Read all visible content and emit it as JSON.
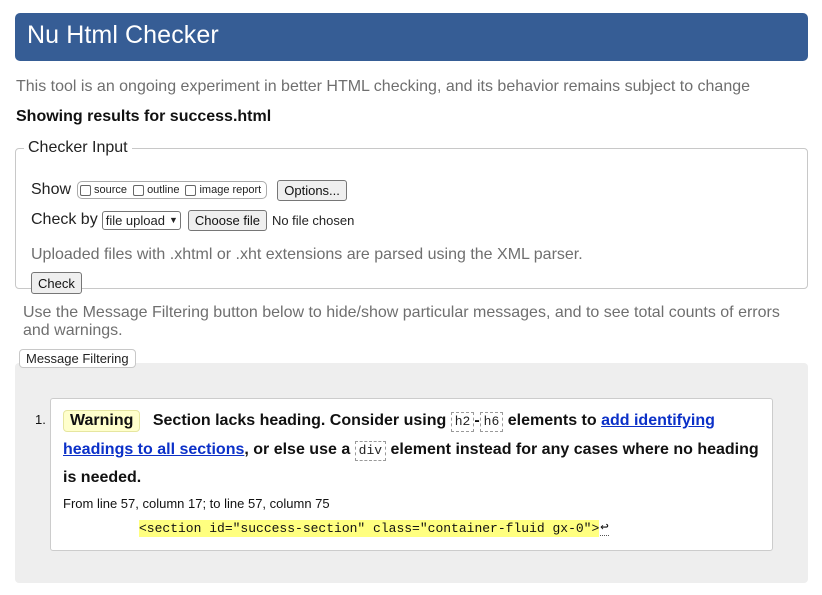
{
  "header": {
    "title": "Nu Html Checker"
  },
  "intro_text": "This tool is an ongoing experiment in better HTML checking, and its behavior remains subject to change",
  "results_for": "Showing results for success.html",
  "checker_input": {
    "legend": "Checker Input",
    "show_label": "Show",
    "checkboxes": [
      {
        "label": "source",
        "checked": false
      },
      {
        "label": "outline",
        "checked": false
      },
      {
        "label": "image report",
        "checked": false
      }
    ],
    "options_button": "Options...",
    "check_by_label": "Check by",
    "check_by_value": "file upload",
    "choose_file_button": "Choose file",
    "no_file_text": "No file chosen",
    "xml_note": "Uploaded files with .xhtml or .xht extensions are parsed using the XML parser.",
    "check_button": "Check"
  },
  "filter_note": "Use the Message Filtering button below to hide/show particular messages, and to see total counts of errors and warnings.",
  "filter_button": "Message Filtering",
  "messages": [
    {
      "number": "1.",
      "type": "Warning",
      "text_1": "Section lacks heading. Consider using",
      "code_1": "h2",
      "dash": "-",
      "code_2": "h6",
      "text_2": "elements to",
      "link": "add identifying headings to all sections",
      "text_3": ", or else use a",
      "code_3": "div",
      "text_4": "element instead for any cases where no heading is needed.",
      "location": "From line 57, column 17; to line 57, column 75",
      "extract": "<section id=\"success-section\" class=\"container-fluid gx-0\">",
      "return_glyph": "↩"
    }
  ],
  "colors": {
    "header_bg": "#365d95",
    "warning_bg": "#ffffcc",
    "highlight": "#ffff80",
    "link": "#0b30c8"
  }
}
